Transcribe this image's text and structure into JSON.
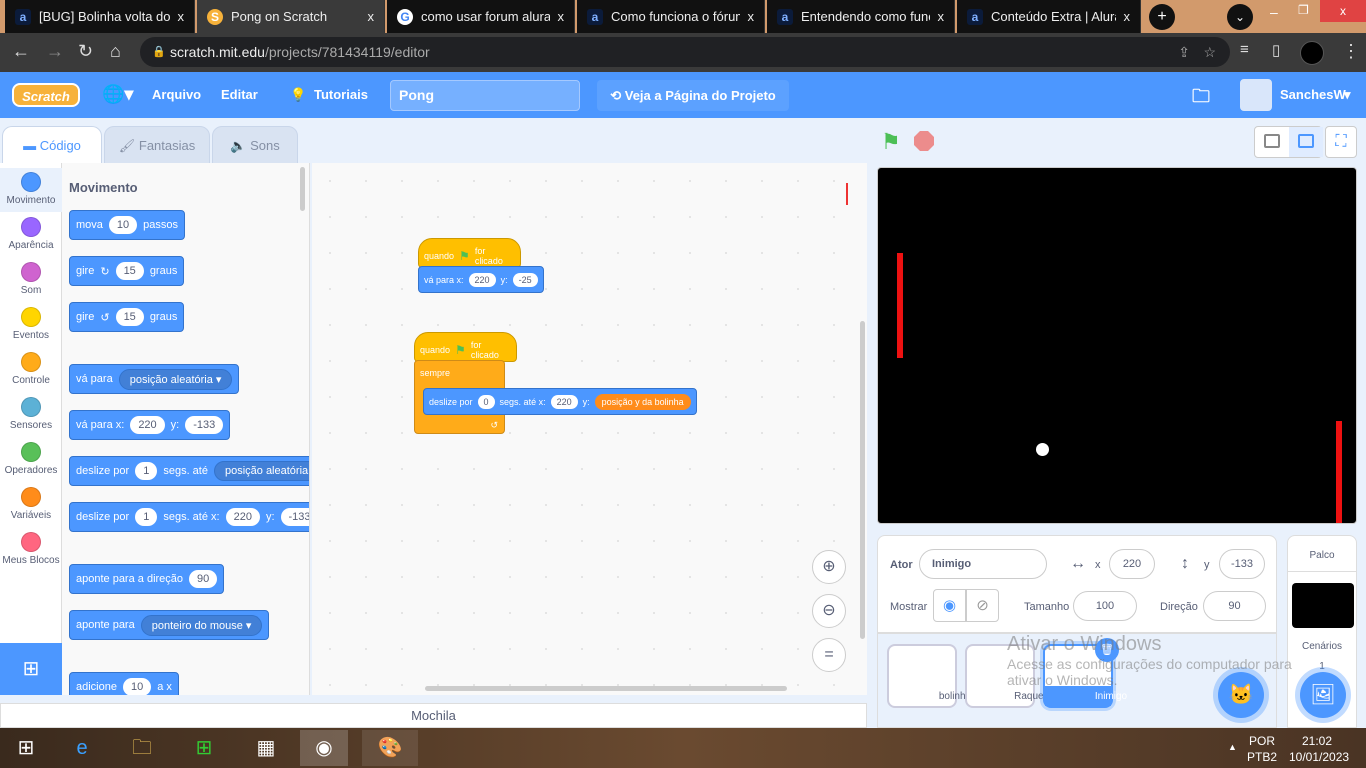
{
  "browser": {
    "tabs": [
      {
        "title": "[BUG] Bolinha volta do",
        "icon": "alura-icon"
      },
      {
        "title": "Pong on Scratch",
        "icon": "scratch-icon",
        "active": true
      },
      {
        "title": "como usar forum alura",
        "icon": "google-icon"
      },
      {
        "title": "Como funciona o fórum",
        "icon": "alura-icon"
      },
      {
        "title": "Entendendo como func",
        "icon": "alura-icon"
      },
      {
        "title": "Conteúdo Extra | Alura",
        "icon": "alura-icon"
      }
    ],
    "close_glyph": "x",
    "url_host": "scratch.mit.edu",
    "url_path": "/projects/781434119/editor"
  },
  "menubar": {
    "logo": "Scratch",
    "file": "Arquivo",
    "edit": "Editar",
    "tutorials": "Tutoriais",
    "project_title": "Pong",
    "see_project": "Veja a Página do Projeto",
    "username": "SanchesW"
  },
  "editor_tabs": {
    "code": "Código",
    "costumes": "Fantasias",
    "sounds": "Sons"
  },
  "categories": [
    {
      "label": "Movimento",
      "color": "#4c97ff"
    },
    {
      "label": "Aparência",
      "color": "#9966ff"
    },
    {
      "label": "Som",
      "color": "#cf63cf"
    },
    {
      "label": "Eventos",
      "color": "#ffd500"
    },
    {
      "label": "Controle",
      "color": "#ffab19"
    },
    {
      "label": "Sensores",
      "color": "#5cb1d6"
    },
    {
      "label": "Operadores",
      "color": "#59c059"
    },
    {
      "label": "Variáveis",
      "color": "#ff8c1a"
    },
    {
      "label": "Meus Blocos",
      "color": "#ff6680"
    }
  ],
  "palette": {
    "heading": "Movimento",
    "move": {
      "a": "mova",
      "v": "10",
      "b": "passos"
    },
    "turn_right": {
      "a": "gire",
      "v": "15",
      "b": "graus"
    },
    "turn_left": {
      "a": "gire",
      "v": "15",
      "b": "graus"
    },
    "goto": {
      "a": "vá para",
      "d": "posição aleatória"
    },
    "goto_xy": {
      "a": "vá para x:",
      "x": "220",
      "b": "y:",
      "y": "-133"
    },
    "glide_to": {
      "a": "deslize por",
      "v": "1",
      "b": "segs. até",
      "d": "posição aleatória"
    },
    "glide_xy": {
      "a": "deslize por",
      "v": "1",
      "b": "segs. até x:",
      "x": "220",
      "c": "y:",
      "y": "-133"
    },
    "point_dir": {
      "a": "aponte para a direção",
      "v": "90"
    },
    "point_to": {
      "a": "aponte para",
      "d": "ponteiro do mouse"
    },
    "change_x": {
      "a": "adicione",
      "v": "10",
      "b": "a x"
    }
  },
  "scripts": {
    "s1": {
      "hat_a": "quando",
      "hat_b": "for clicado",
      "goto_a": "vá para x:",
      "x": "220",
      "goto_b": "y:",
      "y": "-25"
    },
    "s2": {
      "hat_a": "quando",
      "hat_b": "for clicado",
      "forever": "sempre",
      "glide_a": "deslize por",
      "secs": "0",
      "glide_b": "segs. até x:",
      "x": "220",
      "glide_c": "y:",
      "reporter": "posição y da bolinha"
    }
  },
  "backpack": "Mochila",
  "sprite_info": {
    "sprite_label": "Ator",
    "sprite_name": "Inimigo",
    "x_label": "x",
    "x": "220",
    "y_label": "y",
    "y": "-133",
    "show_label": "Mostrar",
    "size_label": "Tamanho",
    "size": "100",
    "dir_label": "Direção",
    "dir": "90"
  },
  "sprites": [
    {
      "name": "bolinha"
    },
    {
      "name": "Raquete"
    },
    {
      "name": "Inimigo",
      "selected": true
    }
  ],
  "stage_pane": {
    "title": "Palco",
    "backdrops_label": "Cenários",
    "backdrops": "1"
  },
  "watermark": {
    "title": "Ativar o Windows",
    "line1": "Acesse as configurações do computador para",
    "line2": "ativar o Windows."
  },
  "taskbar": {
    "lang1": "POR",
    "lang2": "PTB2",
    "time": "21:02",
    "date": "10/01/2023"
  }
}
